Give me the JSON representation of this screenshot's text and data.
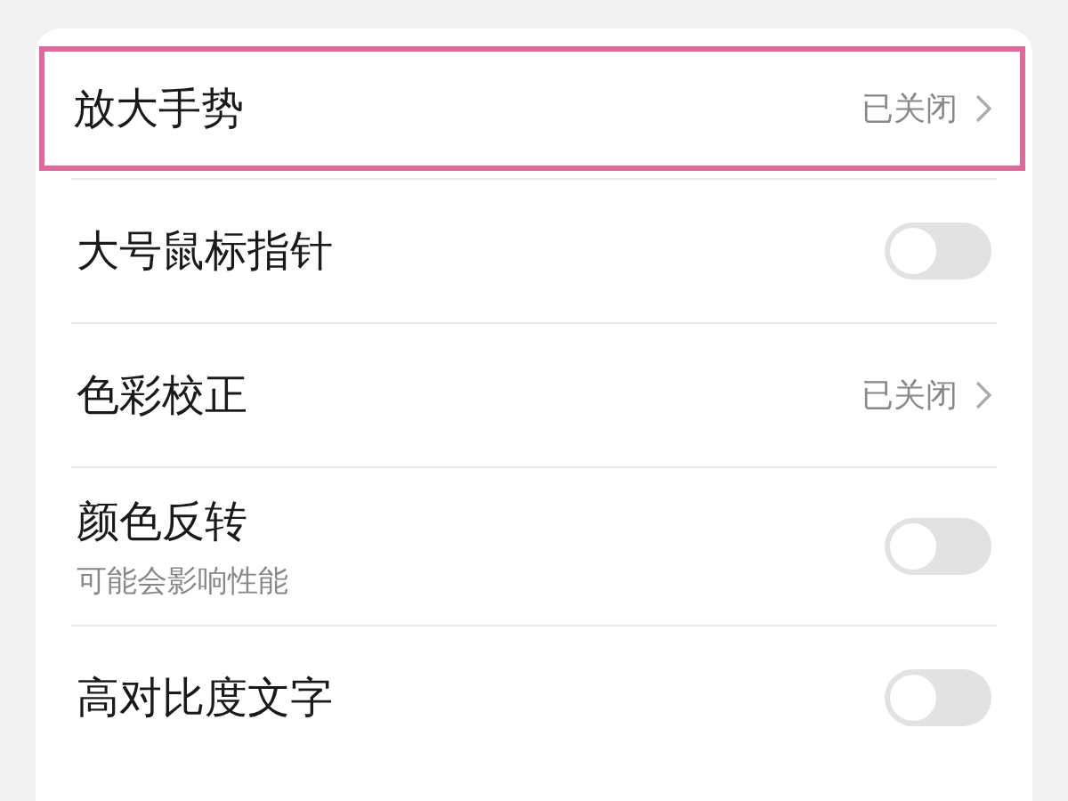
{
  "settings": [
    {
      "kind": "link",
      "title": "放大手势",
      "value": "已关闭",
      "highlighted": true
    },
    {
      "kind": "toggle",
      "title": "大号鼠标指针",
      "on": false,
      "highlighted": false
    },
    {
      "kind": "link",
      "title": "色彩校正",
      "value": "已关闭",
      "highlighted": false
    },
    {
      "kind": "toggle",
      "title": "颜色反转",
      "subtitle": "可能会影响性能",
      "on": false,
      "highlighted": false
    },
    {
      "kind": "toggle",
      "title": "高对比度文字",
      "on": false,
      "highlighted": false
    }
  ]
}
